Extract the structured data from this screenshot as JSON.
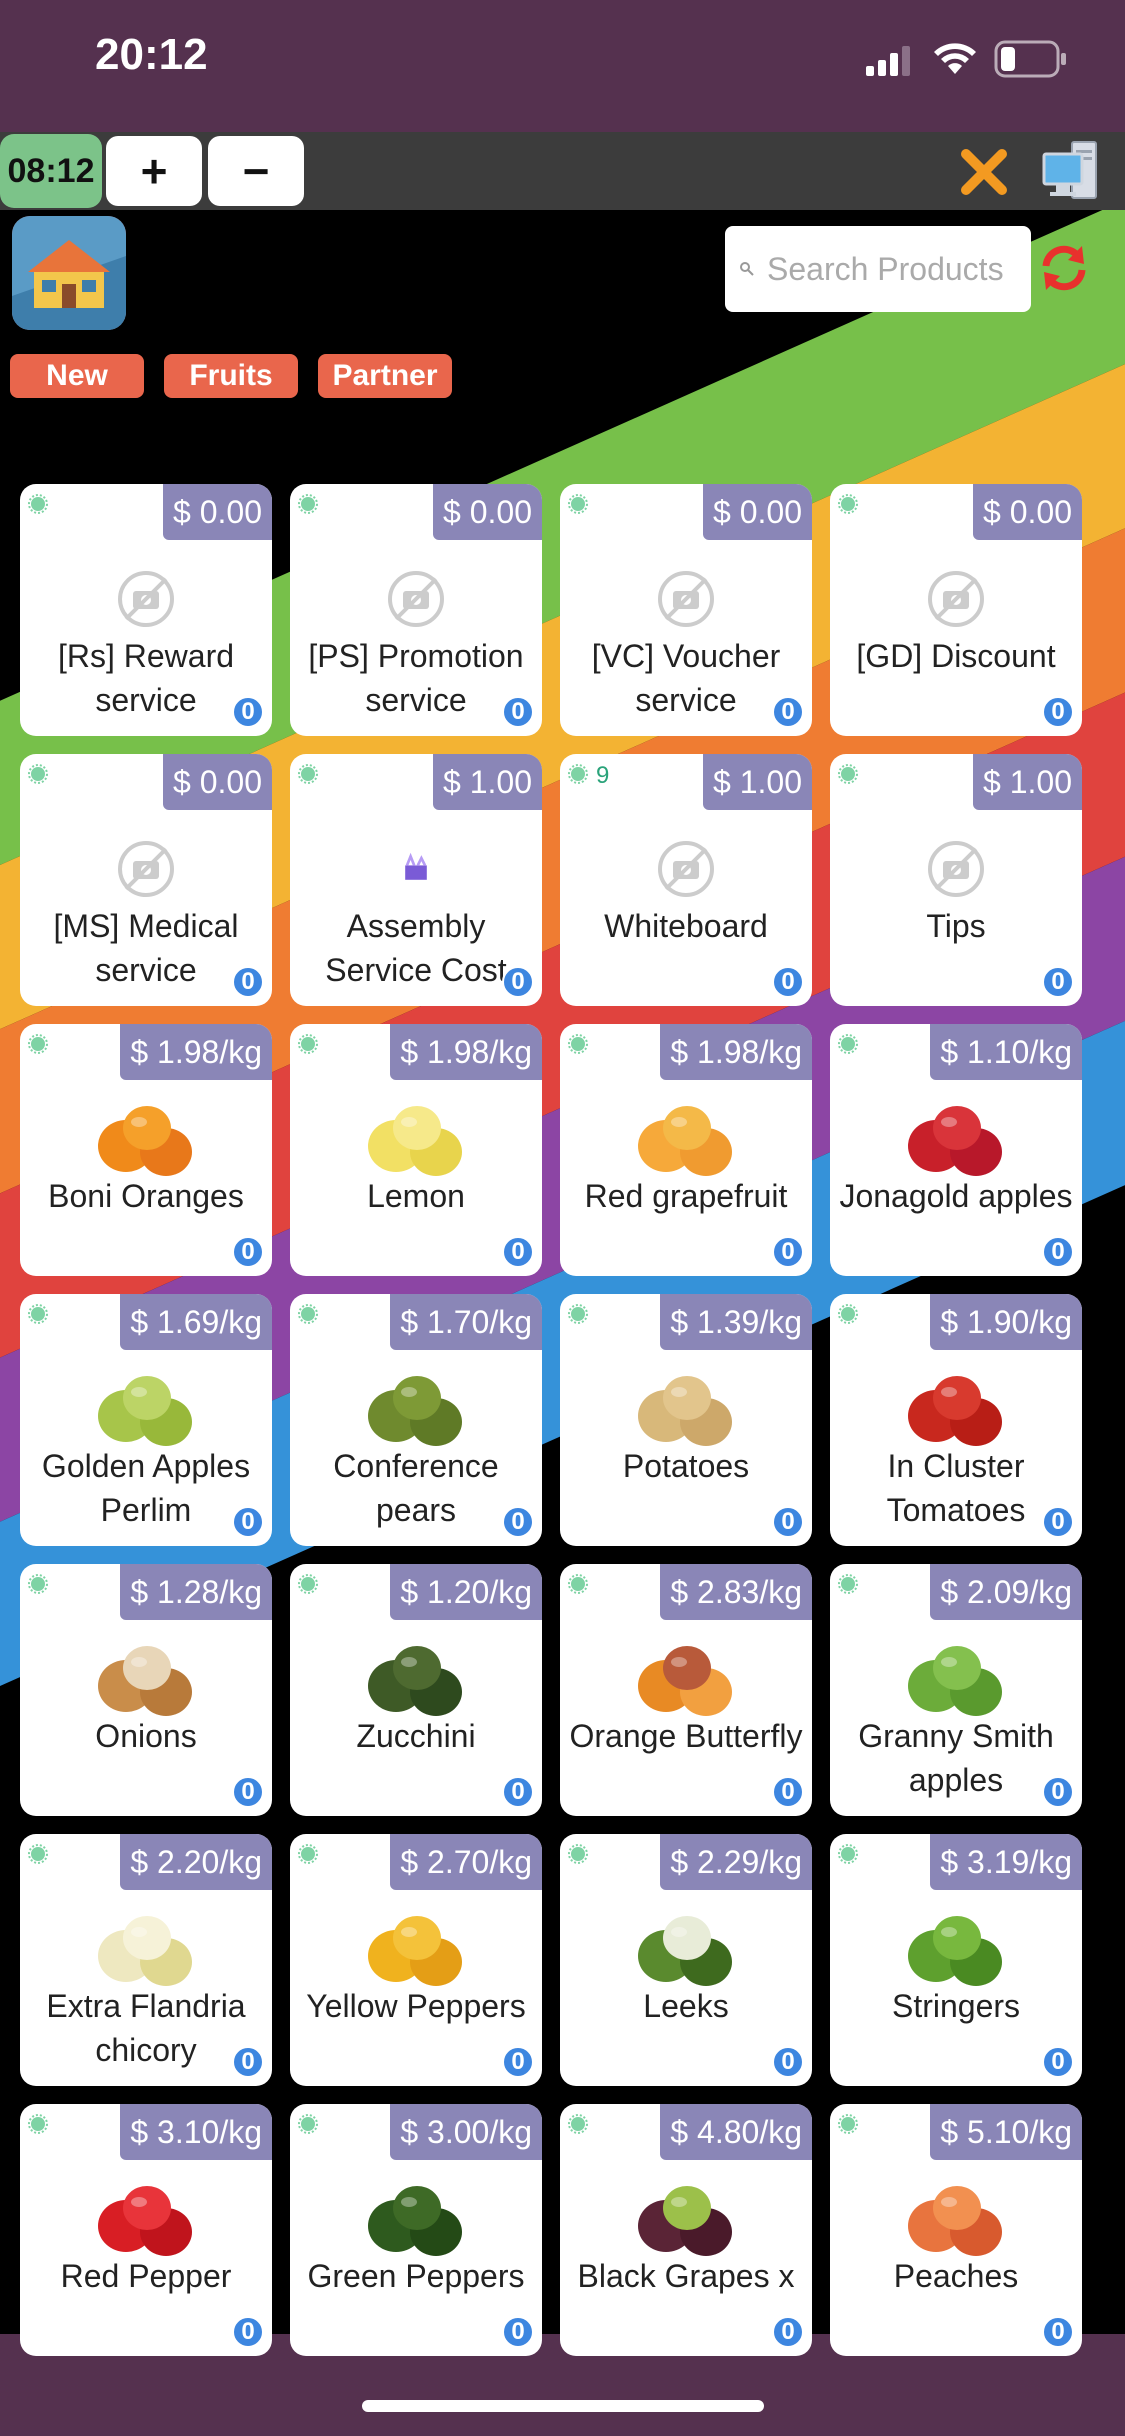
{
  "status_bar": {
    "time": "20:12"
  },
  "toolbar": {
    "timer": "08:12",
    "plus_label": "+",
    "minus_label": "−"
  },
  "search": {
    "placeholder": "Search Products"
  },
  "categories": [
    {
      "label": "New"
    },
    {
      "label": "Fruits"
    },
    {
      "label": "Partner"
    }
  ],
  "colors": {
    "accent": "#e9664c",
    "price_badge": "#8a86b7",
    "qty_badge": "#3d86e0",
    "background": "#55314f",
    "timer": "#7cc389"
  },
  "products": [
    {
      "name": "[Rs] Reward service",
      "price": "$ 0.00",
      "qty": "0",
      "image": "no-photo-icon"
    },
    {
      "name": "[PS] Promotion service",
      "price": "$ 0.00",
      "qty": "0",
      "image": "no-photo-icon"
    },
    {
      "name": "[VC] Voucher service",
      "price": "$ 0.00",
      "qty": "0",
      "image": "no-photo-icon"
    },
    {
      "name": "[GD] Discount",
      "price": "$ 0.00",
      "qty": "0",
      "image": "no-photo-icon"
    },
    {
      "name": "[MS] Medical service",
      "price": "$ 0.00",
      "qty": "0",
      "image": "no-photo-icon"
    },
    {
      "name": "Assembly Service Cost",
      "price": "$ 1.00",
      "qty": "0",
      "image": "assembly-icon"
    },
    {
      "name": "Whiteboard",
      "price": "$ 1.00",
      "qty": "0",
      "image": "no-photo-icon",
      "count": "9"
    },
    {
      "name": "Tips",
      "price": "$ 1.00",
      "qty": "0",
      "image": "no-photo-icon"
    },
    {
      "name": "Boni Oranges",
      "price": "$ 1.98/kg",
      "qty": "0",
      "image": "oranges"
    },
    {
      "name": "Lemon",
      "price": "$ 1.98/kg",
      "qty": "0",
      "image": "lemon"
    },
    {
      "name": "Red grapefruit",
      "price": "$ 1.98/kg",
      "qty": "0",
      "image": "grapefruit"
    },
    {
      "name": "Jonagold apples",
      "price": "$ 1.10/kg",
      "qty": "0",
      "image": "red-apples"
    },
    {
      "name": "Golden Apples Perlim",
      "price": "$ 1.69/kg",
      "qty": "0",
      "image": "green-apples"
    },
    {
      "name": "Conference pears",
      "price": "$ 1.70/kg",
      "qty": "0",
      "image": "pears"
    },
    {
      "name": "Potatoes",
      "price": "$ 1.39/kg",
      "qty": "0",
      "image": "potatoes"
    },
    {
      "name": "In Cluster Tomatoes",
      "price": "$ 1.90/kg",
      "qty": "0",
      "image": "tomatoes"
    },
    {
      "name": "Onions",
      "price": "$ 1.28/kg",
      "qty": "0",
      "image": "onions"
    },
    {
      "name": "Zucchini",
      "price": "$ 1.20/kg",
      "qty": "0",
      "image": "zucchini"
    },
    {
      "name": "Orange Butterfly",
      "price": "$ 2.83/kg",
      "qty": "0",
      "image": "orange-butterfly"
    },
    {
      "name": "Granny Smith apples",
      "price": "$ 2.09/kg",
      "qty": "0",
      "image": "granny-smith"
    },
    {
      "name": "Extra Flandria chicory",
      "price": "$ 2.20/kg",
      "qty": "0",
      "image": "chicory"
    },
    {
      "name": "Yellow Peppers",
      "price": "$ 2.70/kg",
      "qty": "0",
      "image": "yellow-peppers"
    },
    {
      "name": "Leeks",
      "price": "$ 2.29/kg",
      "qty": "0",
      "image": "leeks"
    },
    {
      "name": "Stringers",
      "price": "$ 3.19/kg",
      "qty": "0",
      "image": "limes"
    },
    {
      "name": "Red Pepper",
      "price": "$ 3.10/kg",
      "qty": "0",
      "image": "red-pepper"
    },
    {
      "name": "Green Peppers",
      "price": "$ 3.00/kg",
      "qty": "0",
      "image": "green-peppers"
    },
    {
      "name": "Black Grapes x",
      "price": "$ 4.80/kg",
      "qty": "0",
      "image": "grapes"
    },
    {
      "name": "Peaches",
      "price": "$ 5.10/kg",
      "qty": "0",
      "image": "peaches"
    }
  ]
}
